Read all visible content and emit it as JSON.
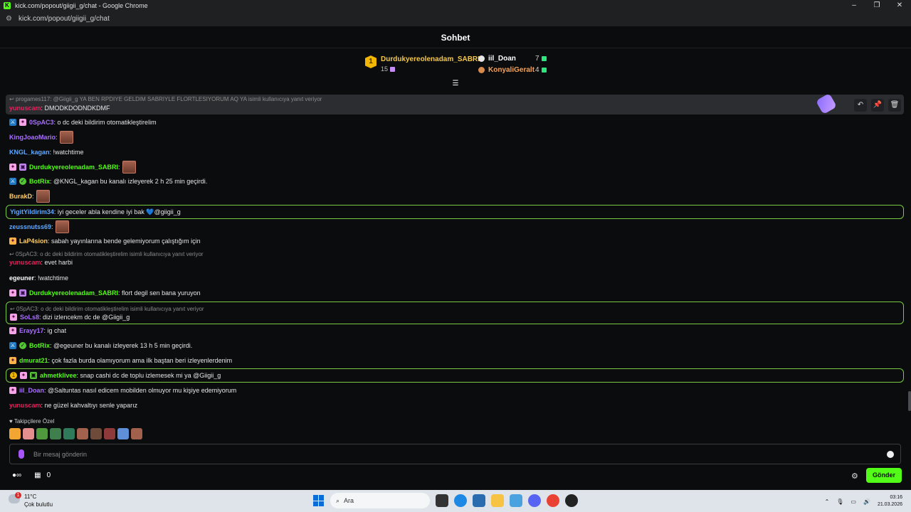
{
  "browser": {
    "title": "kick.com/popout/giigii_g/chat - Google Chrome",
    "url": "kick.com/popout/giigii_g/chat",
    "controls": [
      "–",
      "❐",
      "✕"
    ]
  },
  "header": {
    "title": "Sohbet"
  },
  "leaderboard": {
    "first": {
      "rank": "1",
      "name": "Durdukyereolenadam_SABRI",
      "count": "15"
    },
    "second": {
      "name": "iil_Doan",
      "count": "7"
    },
    "third": {
      "name": "KonyaliGeralt",
      "count": "4"
    }
  },
  "pinned": {
    "reply": "progames117: @Giigii_g YA BEN RPDIYE GELDIM SABRIYLE FLORTLESIYORUM AQ YA isimli kullanıcıya yanıt veriyor",
    "name": "yunuscam",
    "text": ": DMODKDODNDKDMF"
  },
  "messages": [
    {
      "name": "0SpAC3",
      "text": ": o dc deki bildirim otomatikleştirelim"
    },
    {
      "name": "KingJoaoMario",
      "text": ":"
    },
    {
      "name": "KNGL_kagan",
      "text": ": !watchtime"
    },
    {
      "name": "Durdukyereolenadam_SABRI",
      "text": ":"
    },
    {
      "name": "BotRix",
      "text": ": @KNGL_kagan bu kanalı izleyerek 2 h 25 min geçirdi."
    },
    {
      "name": "BurakD",
      "text": ":"
    },
    {
      "name": "YigitYildirim34",
      "text": ": iyi geceler abla kendine iyi bak 💙@giigii_g"
    },
    {
      "name": "zeussnutss69",
      "text": ":"
    },
    {
      "name": "LaP4sion",
      "text": ": sabah yayınlarına bende gelemiyorum çalıştığım için"
    },
    {
      "reply": "0SpAC3: o dc deki bildirim otomatikleştirelim isimli kullanıcıya yanıt veriyor",
      "name": "yunuscam",
      "text": ": evet harbi"
    },
    {
      "name": "egeuner",
      "text": ": !watchtime"
    },
    {
      "name": "Durdukyereolenadam_SABRI",
      "text": ": flort degil sen bana yuruyon"
    },
    {
      "reply": "0SpAC3: o dc deki bildirim otomatikleştirelim isimli kullanıcıya yanıt veriyor",
      "name": "SoLs8",
      "text": ": dizi izlencekm dc de @Giigii_g"
    },
    {
      "name": "Erayy17",
      "text": ": ig chat"
    },
    {
      "name": "BotRix",
      "text": ": @egeuner bu kanalı izleyerek 13 h 5 min geçirdi."
    },
    {
      "name": "dmurat21",
      "text": ": çok fazla burda olamıyorum ama ilk baştan beri izleyenlerdenim"
    },
    {
      "name": "ahmetklivee",
      "text": ": snap cashi dc de toplu izlemesek mi ya @Giigii_g"
    },
    {
      "name": "iil_Doan",
      "text": ": @Saltuntas nasıl edicem mobilden olmuyor mu kişiye edemiyorum"
    },
    {
      "name": "yunuscam",
      "text": ": ne güzel kahvaltıyı senle yaparız"
    }
  ],
  "colors": {
    "accent": "#53fc18",
    "highlight_border": "#7ac943",
    "purple_name": "#a970ff",
    "green_name": "#53fc18",
    "blue_name": "#5fa8ff",
    "red_name": "#e0245e",
    "gold_name": "#f5c84b",
    "orange_name": "#ff9f43"
  },
  "composer": {
    "followers_label": "Takipçilere Özel",
    "placeholder": "Bir mesaj gönderin",
    "send_label": "Gönder",
    "points": "0"
  },
  "taskbar": {
    "temp": "11°C",
    "weather": "Çok bulutlu",
    "weather_badge": "1",
    "search": "Ara",
    "time": "03:16",
    "date": "21.03.2026"
  }
}
